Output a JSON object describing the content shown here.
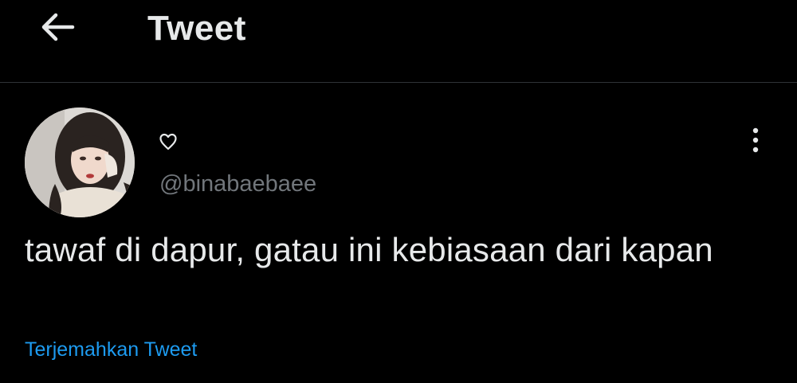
{
  "header": {
    "back_icon": "arrow-left-icon",
    "title": "Tweet"
  },
  "tweet": {
    "avatar_icon": "profile-photo",
    "display_name_icon": "heart-outline-icon",
    "display_name_glyph": "♡",
    "handle": "@binabaebaee",
    "more_icon": "more-vertical-icon",
    "text": "tawaf di dapur, gatau ini kebiasaan dari kapan",
    "translate_label": "Terjemahkan Tweet"
  },
  "colors": {
    "background": "#000000",
    "primary_text": "#e7e9ea",
    "secondary_text": "#71767b",
    "link": "#1d9bf0",
    "divider": "#2f3336"
  }
}
